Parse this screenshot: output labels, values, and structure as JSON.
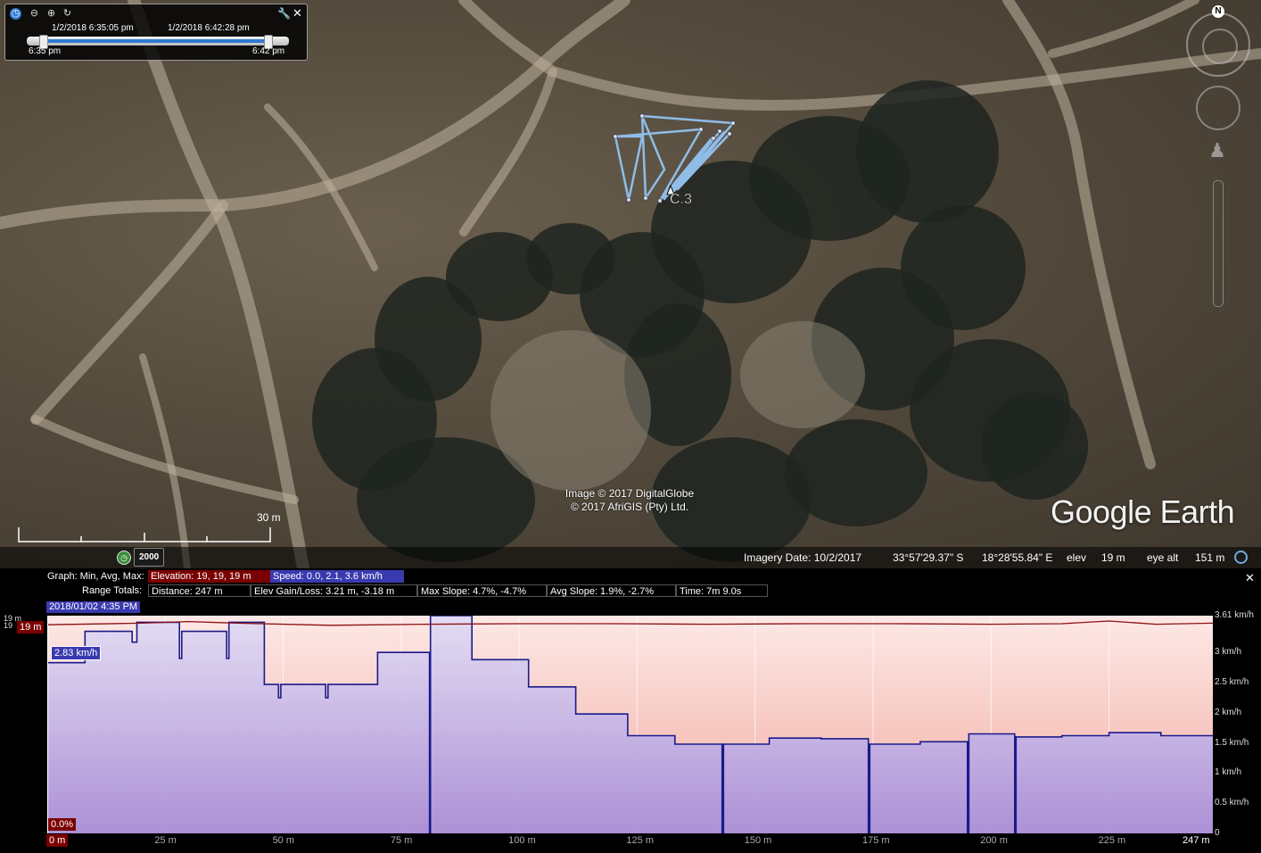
{
  "time_slider": {
    "start_datetime": "1/2/2018   6:35:05 pm",
    "end_datetime": "1/2/2018   6:42:28 pm",
    "range_start_label": "6:35 pm",
    "range_end_label": "6:42 pm"
  },
  "map": {
    "track_label": "C.3",
    "scale_label": "30 m",
    "historical_year": "2000",
    "attribution_line1": "Image © 2017 DigitalGlobe",
    "attribution_line2": "© 2017 AfriGIS (Pty) Ltd.",
    "logo": "Google Earth",
    "compass_north": "N"
  },
  "status_bar": {
    "imagery_date": "Imagery Date: 10/2/2017",
    "latitude": "33°57'29.37\" S",
    "longitude": "18°28'55.84\" E",
    "elev_label": "elev",
    "elev_value": "19 m",
    "eye_alt_label": "eye alt",
    "eye_alt_value": "151 m"
  },
  "graph": {
    "graph_label": "Graph: Min, Avg, Max:",
    "elevation_summary": "Elevation: 19, 19, 19 m",
    "speed_summary": "Speed: 0.0, 2.1, 3.6 km/h",
    "range_totals_label": "Range Totals:",
    "distance": "Distance: 247 m",
    "elev_gain_loss": "Elev Gain/Loss: 3.21 m, -3.18 m",
    "max_slope": "Max Slope: 4.7%, -4.7%",
    "avg_slope": "Avg Slope: 1.9%, -2.7%",
    "time": "Time: 7m 9.0s",
    "cursor_datetime": "2018/01/02 4:35 PM",
    "elev_cursor": "19 m",
    "elev_axis_top": "19 m",
    "elev_axis_sub": "19",
    "speed_cursor": "2.83 km/h",
    "slope_cursor": "0.0%",
    "distance_cursor": "0 m",
    "colors": {
      "elevation": "#7b0000",
      "speed": "#3a3ab0",
      "speed_line": "#1a1a8c",
      "elev_line": "#8b1010"
    }
  },
  "chart_data": {
    "type": "line",
    "xlabel": "",
    "ylabel": "",
    "x_ticks": [
      "25 m",
      "50 m",
      "75 m",
      "100 m",
      "125 m",
      "150 m",
      "175 m",
      "200 m",
      "225 m",
      "247 m"
    ],
    "x_tick_values": [
      25,
      50,
      75,
      100,
      125,
      150,
      175,
      200,
      225,
      247
    ],
    "y_ticks_right": [
      "3.61 km/h",
      "3 km/h",
      "2.5 km/h",
      "2 km/h",
      "1.5 km/h",
      "1 km/h",
      "0.5 km/h",
      "0"
    ],
    "y_tick_values_right": [
      3.61,
      3.0,
      2.5,
      2.0,
      1.5,
      1.0,
      0.5,
      0
    ],
    "xlim": [
      0,
      247
    ],
    "ylim_speed": [
      0,
      3.61
    ],
    "series": [
      {
        "name": "Speed",
        "x": [
          0,
          8,
          8,
          18,
          18,
          19,
          19,
          28,
          28,
          28.5,
          28.5,
          38,
          38,
          38.5,
          38.5,
          46,
          46,
          49,
          49,
          49.5,
          49.5,
          59,
          59,
          59.5,
          59.5,
          70,
          70,
          81,
          81,
          81.2,
          81.2,
          90,
          90,
          102,
          102,
          112,
          112,
          123,
          123,
          133,
          133,
          143,
          143,
          143.3,
          143.3,
          153,
          153,
          164,
          164,
          174,
          174,
          174.3,
          174.3,
          185,
          185,
          195,
          195,
          195.3,
          195.3,
          205,
          205,
          205.3,
          205.3,
          215,
          215,
          225,
          225,
          236,
          236,
          247
        ],
        "y": [
          2.83,
          2.83,
          3.35,
          3.35,
          3.17,
          3.17,
          3.5,
          3.5,
          2.9,
          2.9,
          3.35,
          3.35,
          2.9,
          2.9,
          3.5,
          3.5,
          2.47,
          2.47,
          2.25,
          2.25,
          2.47,
          2.47,
          2.25,
          2.25,
          2.47,
          2.47,
          3.0,
          3.0,
          0,
          0,
          3.61,
          3.61,
          2.88,
          2.88,
          2.43,
          2.43,
          1.98,
          1.98,
          1.62,
          1.62,
          1.48,
          1.48,
          0,
          0,
          1.48,
          1.48,
          1.58,
          1.58,
          1.57,
          1.57,
          0,
          0,
          1.48,
          1.48,
          1.52,
          1.52,
          0,
          0,
          1.65,
          1.65,
          0,
          0,
          1.6,
          1.6,
          1.62,
          1.62,
          1.67,
          1.67,
          1.62,
          1.62
        ]
      },
      {
        "name": "Elevation",
        "x": [
          0,
          20,
          30,
          40,
          60,
          80,
          100,
          120,
          140,
          160,
          180,
          200,
          215,
          225,
          235,
          247
        ],
        "y": [
          19,
          19.3,
          19.6,
          19.3,
          18.9,
          19.1,
          19.2,
          19.2,
          19.1,
          19.2,
          19.2,
          19.1,
          19.2,
          19.7,
          19.1,
          19.3
        ]
      }
    ]
  }
}
